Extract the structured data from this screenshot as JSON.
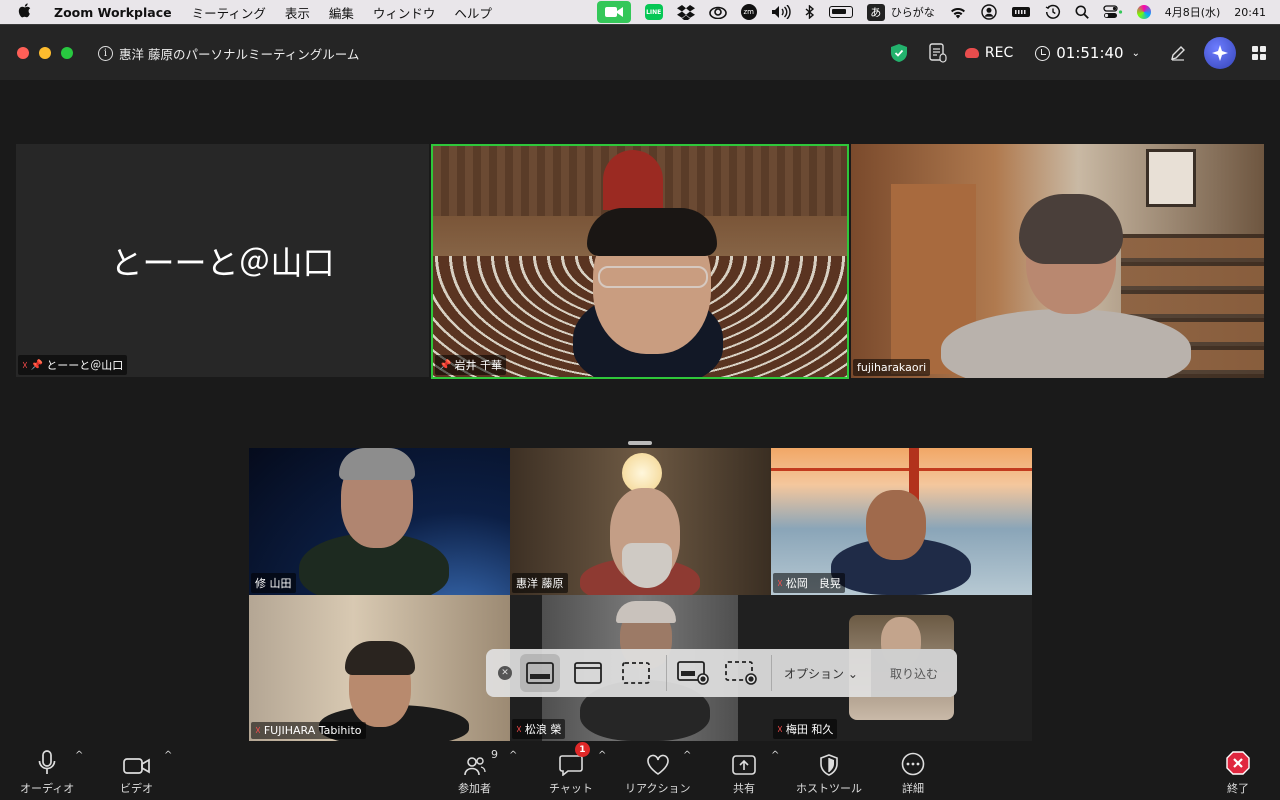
{
  "menubar": {
    "app_name": "Zoom Workplace",
    "menus": [
      "ミーティング",
      "表示",
      "編集",
      "ウィンドウ",
      "ヘルプ"
    ],
    "line_label": "LINE",
    "zm_label": "zm",
    "ime_indicator": "あ",
    "ime_mode": "ひらがな",
    "date": "4月8日(水)",
    "time": "20:41"
  },
  "window": {
    "meeting_title": "惠洋 藤原のパーソナルミーティングルーム",
    "rec_label": "REC",
    "elapsed": "01:51:40"
  },
  "tiles": {
    "top": [
      {
        "name": "とーーと＠山口",
        "display_text": "とーーと＠山口",
        "muted": true,
        "pinned": true
      },
      {
        "name": "岩井 千華",
        "muted": false,
        "pinned": true,
        "active_speaker": true
      },
      {
        "name": "fujiharakaori",
        "muted": false,
        "pinned": false
      }
    ],
    "grid": [
      {
        "name": "修 山田",
        "muted": false
      },
      {
        "name": "惠洋 藤原",
        "muted": false
      },
      {
        "name": "松岡　良晃",
        "muted": true
      },
      {
        "name": "FUJIHARA Tabihito",
        "muted": true
      },
      {
        "name": "松浪 榮",
        "muted": true
      },
      {
        "name": "梅田 和久",
        "muted": true
      }
    ]
  },
  "capture_toolbar": {
    "options_label": "オプション",
    "capture_label": "取り込む"
  },
  "controls": {
    "audio": "オーディオ",
    "video": "ビデオ",
    "participants": "参加者",
    "participants_count": "9",
    "chat": "チャット",
    "chat_badge": "1",
    "reactions": "リアクション",
    "share": "共有",
    "host_tools": "ホストツール",
    "more": "詳細",
    "end": "終了"
  },
  "colors": {
    "active_speaker_border": "#2fc73a",
    "end_button": "#e0273f",
    "mute_red": "#ff4d4d"
  }
}
